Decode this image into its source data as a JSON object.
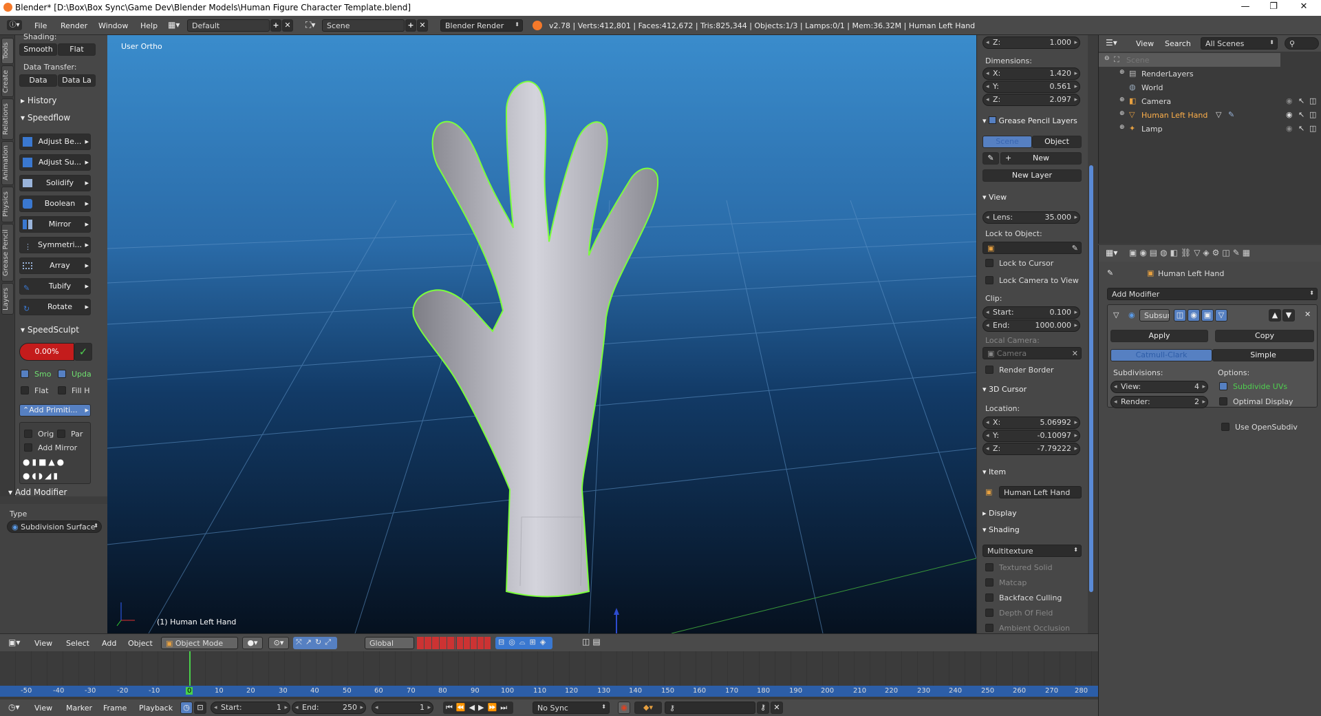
{
  "window": {
    "title": "Blender* [D:\\Box\\Box Sync\\Game Dev\\Blender Models\\Human Figure Character Template.blend]",
    "minimize_glyph": "—",
    "maximize_glyph": "❐",
    "close_glyph": "✕"
  },
  "menubar": {
    "items": [
      "File",
      "Render",
      "Window",
      "Help"
    ],
    "layout": "Default",
    "scene": "Scene",
    "engine": "Blender Render",
    "stats": "v2.78 | Verts:412,801 | Faces:412,672 | Tris:825,344 | Objects:1/3 | Lamps:0/1 | Mem:36.32M | Human Left Hand"
  },
  "left_tabs": [
    "Tools",
    "Create",
    "Relations",
    "Animation",
    "Physics",
    "Grease Pencil",
    "Layers"
  ],
  "toolshelf": {
    "shading_label": "Shading:",
    "smooth": "Smooth",
    "flat": "Flat",
    "data_transfer_label": "Data Transfer:",
    "data": "Data",
    "data_layers": "Data La",
    "history": "History",
    "speedflow": "Speedflow",
    "speedflow_items": [
      "Adjust Be...",
      "Adjust Su...",
      "Solidify",
      "Boolean",
      "Mirror",
      "Symmetri...",
      "Array",
      "Tubify",
      "Rotate"
    ],
    "speedsculpt": "SpeedSculpt",
    "percent": "0.00%",
    "smooth_short": "Smo",
    "update_short": "Upda",
    "flat_short": "Flat",
    "fill_short": "Fill H",
    "add_primitive": "Add Primiti...",
    "orig": "Orig",
    "par": "Par",
    "add_mirror": "Add Mirror",
    "add_modifier": "Add Modifier",
    "type_label": "Type",
    "type_value": "Subdivision Surface"
  },
  "viewport": {
    "view_label": "User Ortho",
    "object_label": "(1) Human Left Hand"
  },
  "npanel": {
    "scale_z_label": "Z:",
    "scale_z": "1.000",
    "dimensions_label": "Dimensions:",
    "dim_x": "1.420",
    "dim_y": "0.561",
    "dim_z": "2.097",
    "grease_pencil": "Grease Pencil Layers",
    "gp_scene": "Scene",
    "gp_object": "Object",
    "gp_new": "New",
    "gp_new_layer": "New Layer",
    "view_header": "View",
    "lens_label": "Lens:",
    "lens": "35.000",
    "lock_to_object": "Lock to Object:",
    "lock_to_cursor": "Lock to Cursor",
    "lock_camera": "Lock Camera to View",
    "clip_label": "Clip:",
    "clip_start_label": "Start:",
    "clip_start": "0.100",
    "clip_end_label": "End:",
    "clip_end": "1000.000",
    "local_camera": "Local Camera:",
    "camera_field": "Camera",
    "render_border": "Render Border",
    "cursor_header": "3D Cursor",
    "location_label": "Location:",
    "cur_x": "5.06992",
    "cur_y": "-0.10097",
    "cur_z": "-7.79222",
    "item_header": "Item",
    "item_name": "Human Left Hand",
    "display_header": "Display",
    "shading_header": "Shading",
    "shading_mode": "Multitexture",
    "textured_solid": "Textured Solid",
    "matcap": "Matcap",
    "backface": "Backface Culling",
    "dof": "Depth Of Field",
    "ao": "Ambient Occlusion",
    "x_label": "X:",
    "y_label": "Y:",
    "z_label": "Z:"
  },
  "outliner": {
    "view": "View",
    "search": "Search",
    "scenes": "All Scenes",
    "rows": [
      "Scene",
      "RenderLayers",
      "World",
      "Camera",
      "Human Left Hand",
      "Lamp"
    ]
  },
  "properties": {
    "breadcrumb": "Human Left Hand",
    "add_modifier": "Add Modifier",
    "modifier_name": "Subsur",
    "apply": "Apply",
    "copy": "Copy",
    "catmull": "Catmull-Clark",
    "simple": "Simple",
    "subdivisions": "Subdivisions:",
    "options": "Options:",
    "view_label": "View:",
    "view_value": "4",
    "render_label": "Render:",
    "render_value": "2",
    "subdivide_uvs": "Subdivide UVs",
    "optimal_display": "Optimal Display",
    "use_opensubdiv": "Use OpenSubdiv"
  },
  "vpheader": {
    "items": [
      "View",
      "Select",
      "Add",
      "Object"
    ],
    "mode": "Object Mode",
    "orientation": "Global"
  },
  "timeline": {
    "ticks": [
      "-50",
      "-40",
      "-30",
      "-20",
      "-10",
      "0",
      "10",
      "20",
      "30",
      "40",
      "50",
      "60",
      "70",
      "80",
      "90",
      "100",
      "110",
      "120",
      "130",
      "140",
      "150",
      "160",
      "170",
      "180",
      "190",
      "200",
      "210",
      "220",
      "230",
      "240",
      "250",
      "260",
      "270",
      "280"
    ],
    "items": [
      "View",
      "Marker",
      "Frame",
      "Playback"
    ],
    "start_label": "Start:",
    "start": "1",
    "end_label": "End:",
    "end": "250",
    "current": "1",
    "sync": "No Sync"
  }
}
